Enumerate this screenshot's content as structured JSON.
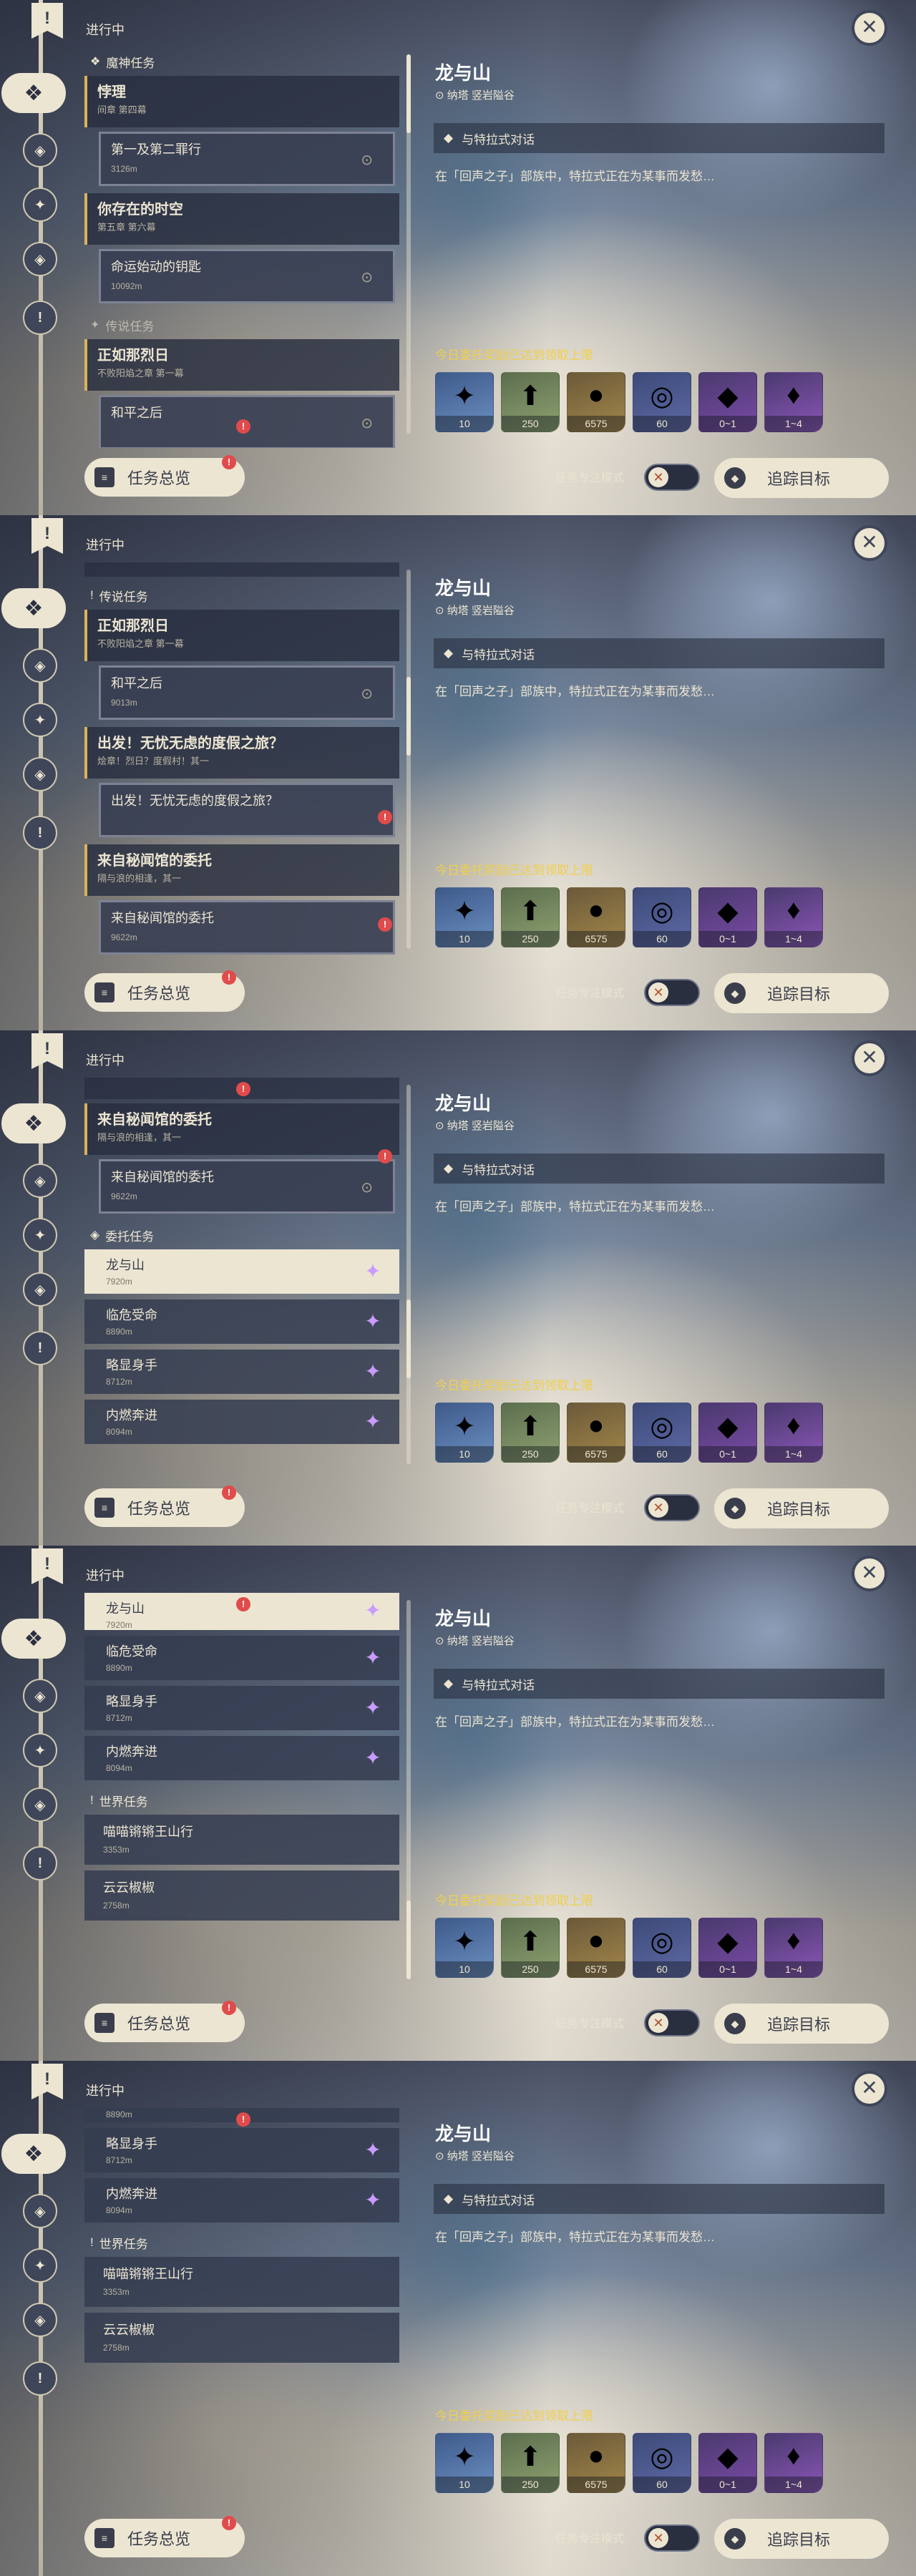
{
  "in_progress": "进行中",
  "sections": {
    "archon": "魔神任务",
    "story": "传说任务",
    "commission": "委托任务",
    "world": "世界任务"
  },
  "quests": {
    "q1": {
      "title": "悖理",
      "sub": "间章 第四幕"
    },
    "q1s": {
      "title": "第一及第二罪行",
      "dist": "3126m"
    },
    "q2": {
      "title": "你存在的时空",
      "sub": "第五章 第六幕"
    },
    "q2s": {
      "title": "命运始动的钥匙",
      "dist": "10092m"
    },
    "q3": {
      "title": "正如那烈日",
      "sub": "不败阳焰之章 第一幕"
    },
    "q3s": {
      "title": "和平之后",
      "dist": "9013m"
    },
    "q4": {
      "title": "出发！无忧无虑的度假之旅？",
      "sub": "烩章！烈日？度假村！其一"
    },
    "q4s": {
      "title": "出发！无忧无虑的度假之旅？"
    },
    "q5": {
      "title": "来自秘闻馆的委托",
      "sub": "隔与浪的相逢，其一"
    },
    "q5s": {
      "title": "来自秘闻馆的委托",
      "dist": "9622m"
    },
    "c1": {
      "title": "龙与山",
      "dist": "7920m"
    },
    "c2": {
      "title": "临危受命",
      "dist": "8890m"
    },
    "c3": {
      "title": "略显身手",
      "dist": "8712m"
    },
    "c4": {
      "title": "内燃奔进",
      "dist": "8094m"
    },
    "w1": {
      "title": "喵喵锵锵王山行",
      "dist": "3353m"
    },
    "w2": {
      "title": "云云椒椒",
      "dist": "2758m"
    }
  },
  "overview": "任务总览",
  "detail": {
    "title": "龙与山",
    "location": "纳塔 竖岩隘谷",
    "objective": "与特拉式对话",
    "description": "在「回声之子」部族中，特拉式正在为某事而发愁…",
    "reward_title": "今日委托奖励已达到领取上限",
    "rewards": [
      "10",
      "250",
      "6575",
      "60",
      "0~1",
      "1~4"
    ]
  },
  "focus_mode": "任务专注模式",
  "track": "追踪目标",
  "icons": {
    "close": "close-icon",
    "track": "target-icon",
    "overview": "book-icon",
    "location": "location-pin-icon"
  }
}
